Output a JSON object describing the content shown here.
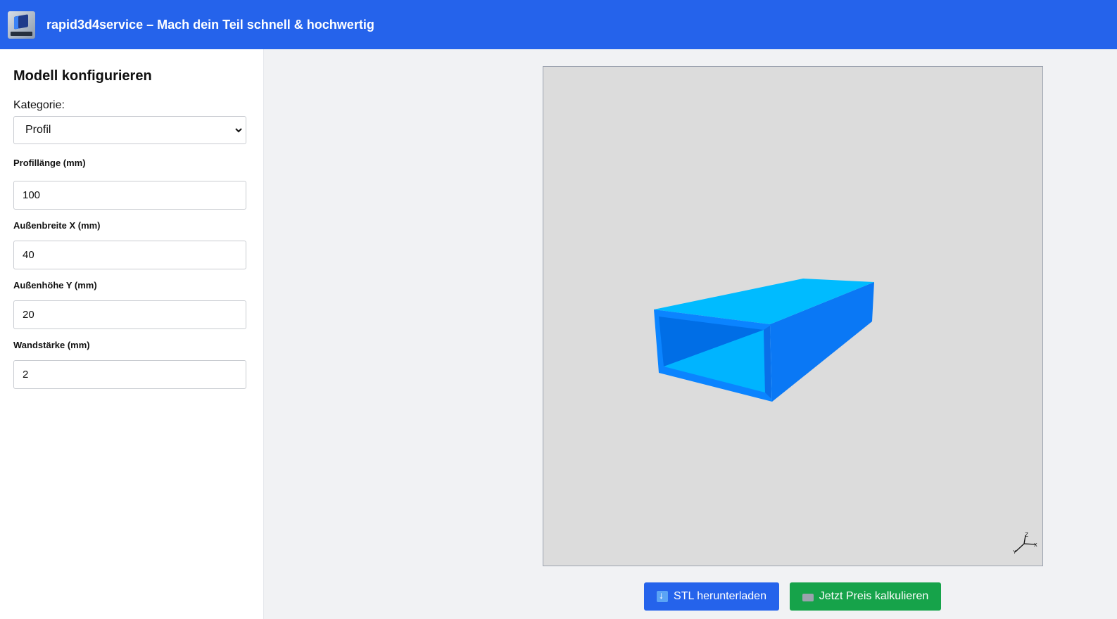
{
  "header": {
    "title": "rapid3d4service – Mach dein Teil schnell & hochwertig"
  },
  "sidebar": {
    "heading": "Modell konfigurieren",
    "category_label": "Kategorie:",
    "category_value": "Profil",
    "fields": [
      {
        "label": "Profillänge (mm)",
        "value": "100"
      },
      {
        "label": "Außenbreite X (mm)",
        "value": "40"
      },
      {
        "label": "Außenhöhe Y (mm)",
        "value": "20"
      },
      {
        "label": "Wandstärke (mm)",
        "value": "2"
      }
    ]
  },
  "viewer": {
    "axis_labels": {
      "z": "Z",
      "x": "X",
      "y": "Y"
    },
    "colors": {
      "background": "#dcdcdc",
      "top_face": "#00bbff",
      "side_face": "#0a78f5",
      "front_face": "#0b84ff",
      "inner_dark": "#006ee6"
    }
  },
  "buttons": {
    "download_label": "STL herunterladen",
    "download_icon": "download-arrow-icon",
    "price_label": "Jetzt Preis kalkulieren",
    "price_icon": "keyboard-icon"
  },
  "colors": {
    "header": "#2563eb",
    "download_button": "#2563eb",
    "price_button": "#16a34a"
  }
}
